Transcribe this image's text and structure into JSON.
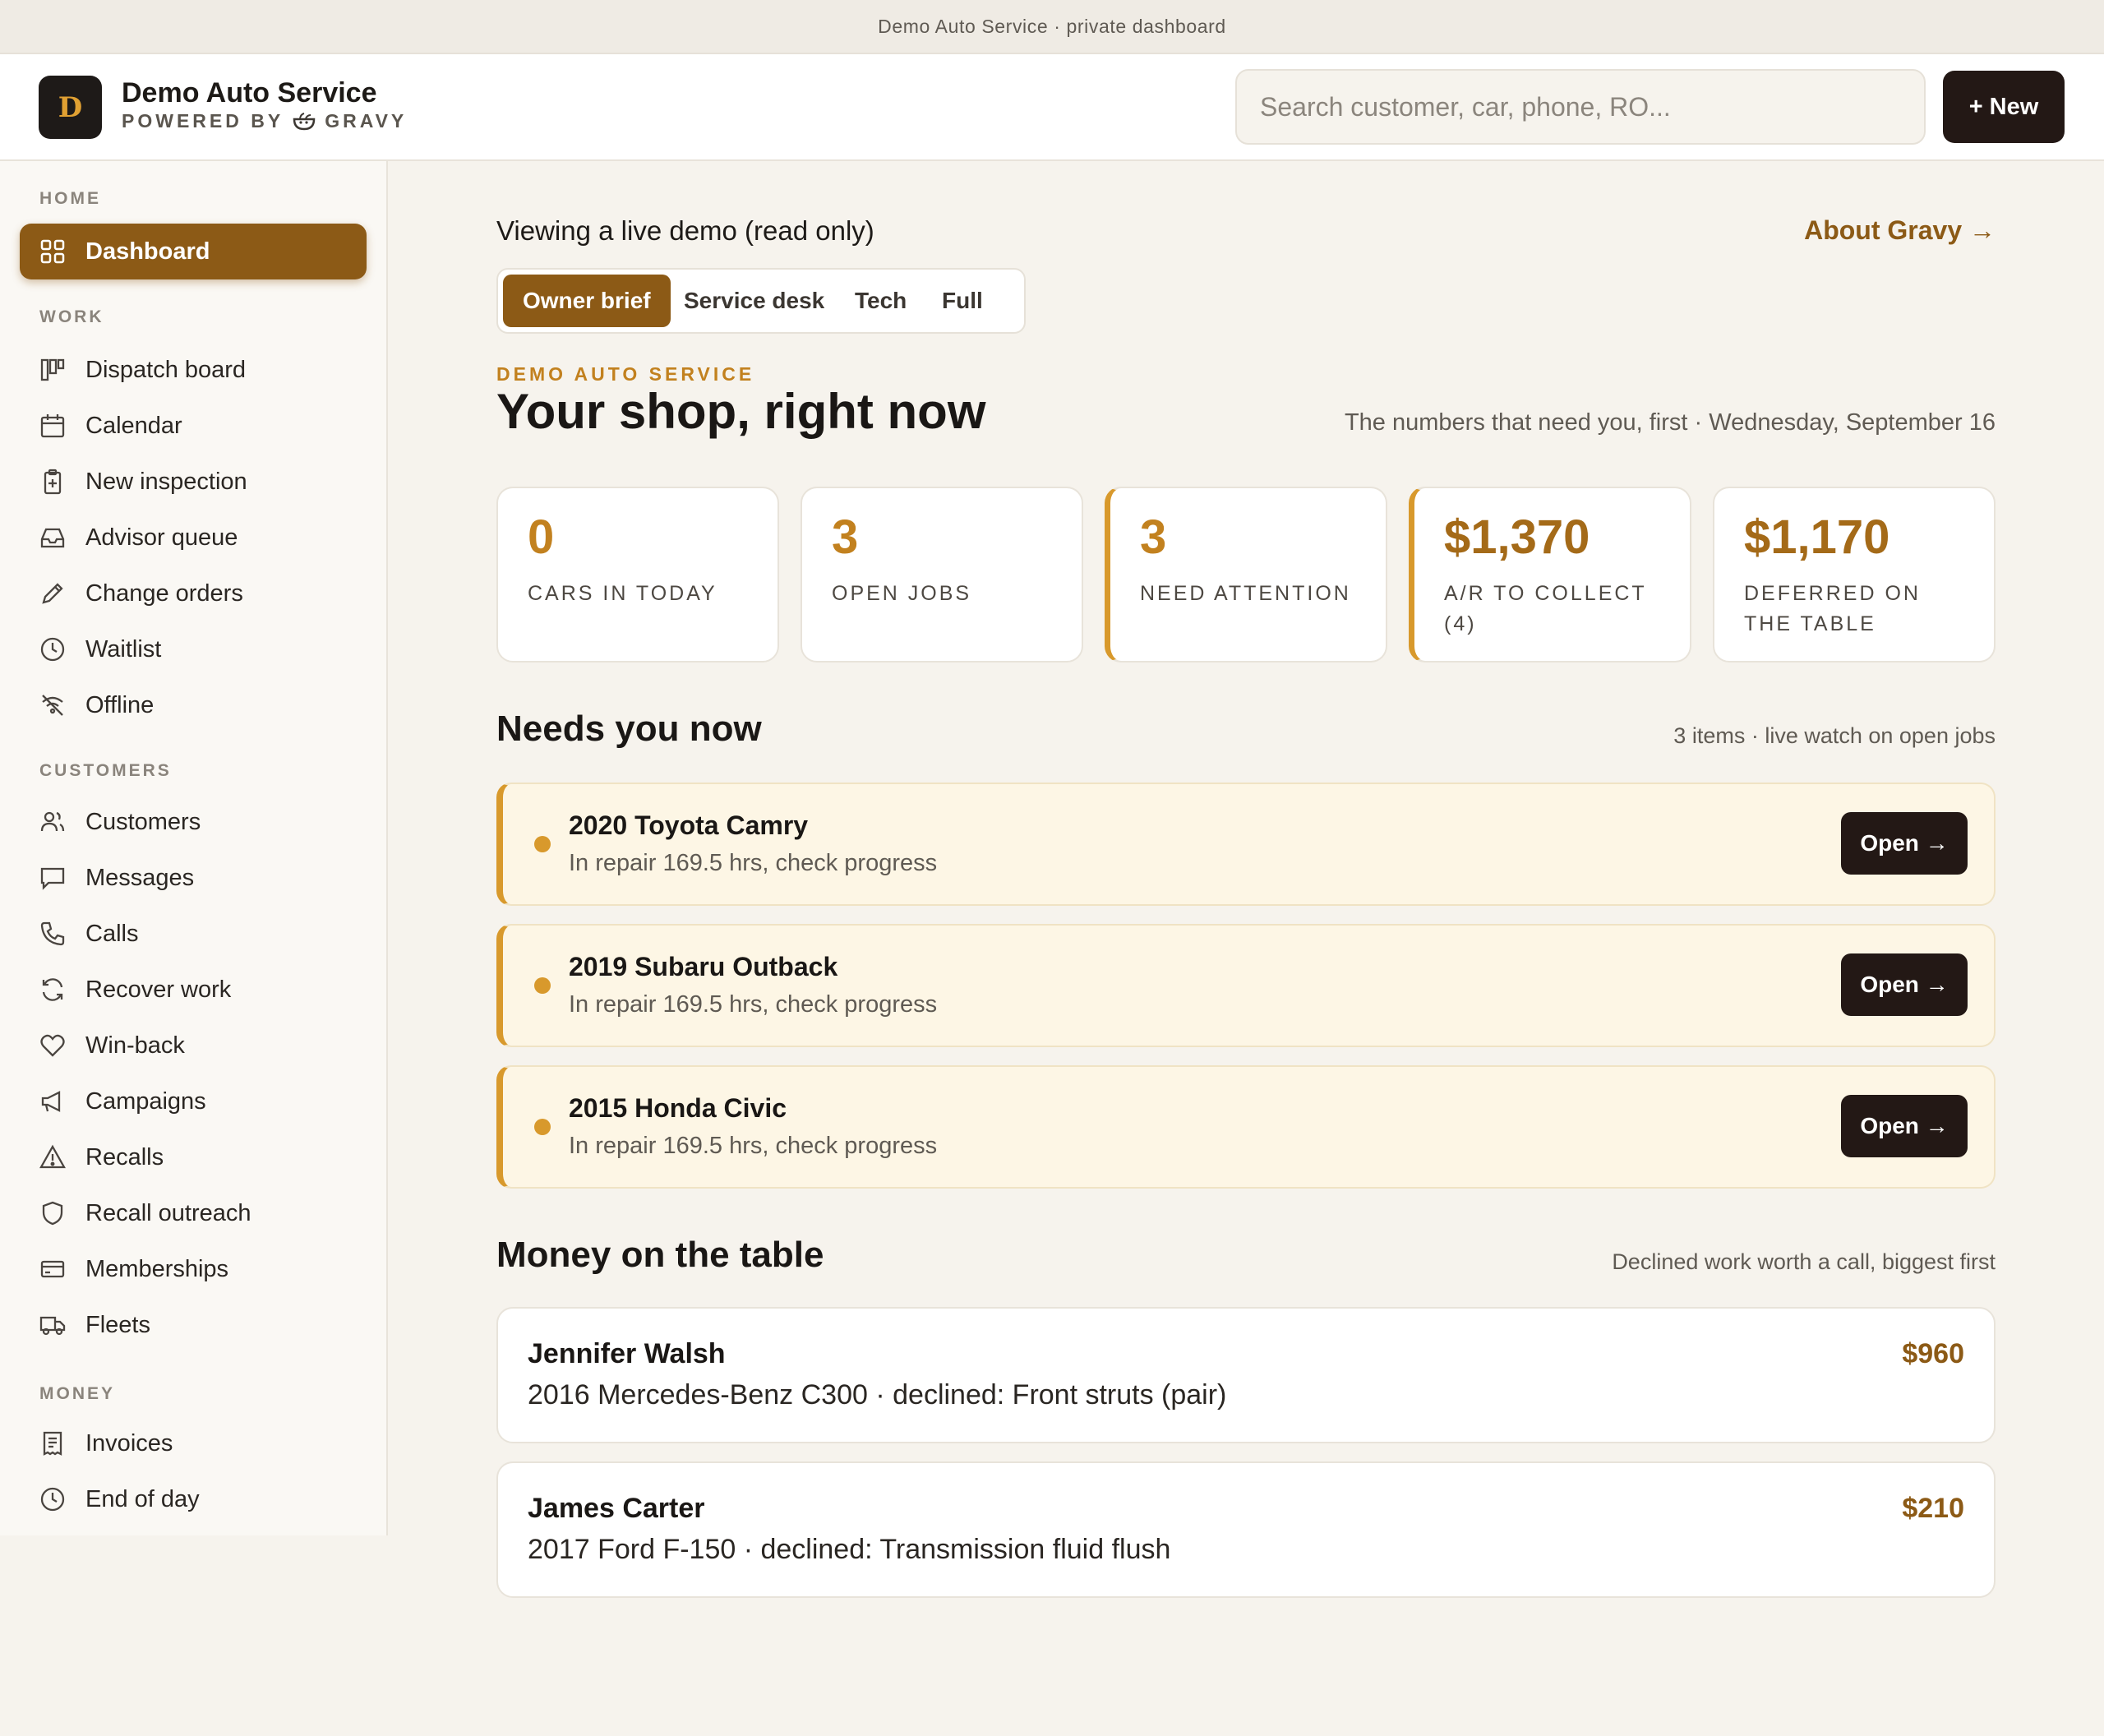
{
  "banner": {
    "text": "Demo Auto Service · private dashboard"
  },
  "header": {
    "logo_letter": "D",
    "brand_name": "Demo Auto Service",
    "powered_prefix": "POWERED BY",
    "powered_brand": "GRAVY",
    "search_placeholder": "Search customer, car, phone, RO...",
    "new_label": "+ New"
  },
  "sidebar": {
    "sections": [
      {
        "label": "HOME",
        "items": [
          {
            "label": "Dashboard",
            "icon": "grid-icon",
            "active": true
          }
        ]
      },
      {
        "label": "WORK",
        "items": [
          {
            "label": "Dispatch board",
            "icon": "board-icon"
          },
          {
            "label": "Calendar",
            "icon": "calendar-icon"
          },
          {
            "label": "New inspection",
            "icon": "clipboard-plus-icon"
          },
          {
            "label": "Advisor queue",
            "icon": "inbox-icon"
          },
          {
            "label": "Change orders",
            "icon": "pencil-icon"
          },
          {
            "label": "Waitlist",
            "icon": "clock-icon"
          },
          {
            "label": "Offline",
            "icon": "offline-icon"
          }
        ]
      },
      {
        "label": "CUSTOMERS",
        "items": [
          {
            "label": "Customers",
            "icon": "users-icon"
          },
          {
            "label": "Messages",
            "icon": "message-icon"
          },
          {
            "label": "Calls",
            "icon": "phone-icon"
          },
          {
            "label": "Recover work",
            "icon": "refresh-icon"
          },
          {
            "label": "Win-back",
            "icon": "heart-icon"
          },
          {
            "label": "Campaigns",
            "icon": "megaphone-icon"
          },
          {
            "label": "Recalls",
            "icon": "warning-icon"
          },
          {
            "label": "Recall outreach",
            "icon": "shield-icon"
          },
          {
            "label": "Memberships",
            "icon": "card-icon"
          },
          {
            "label": "Fleets",
            "icon": "truck-icon"
          }
        ]
      },
      {
        "label": "MONEY",
        "items": [
          {
            "label": "Invoices",
            "icon": "receipt-icon"
          },
          {
            "label": "End of day",
            "icon": "clock-icon"
          }
        ]
      }
    ]
  },
  "main": {
    "viewing_text": "Viewing a live demo (read only)",
    "about_link": "About Gravy →",
    "tabs": [
      "Owner brief",
      "Service desk",
      "Tech",
      "Full"
    ],
    "active_tab": "Owner brief",
    "eyebrow": "DEMO AUTO SERVICE",
    "title": "Your shop, right now",
    "subtitle": "The numbers that need you, first · Wednesday, September 16",
    "stats": [
      {
        "value": "0",
        "label": "CARS IN TODAY",
        "accent": false
      },
      {
        "value": "3",
        "label": "OPEN JOBS",
        "accent": false
      },
      {
        "value": "3",
        "label": "NEED ATTENTION",
        "accent": true
      },
      {
        "value": "$1,370",
        "label": "A/R TO COLLECT (4)",
        "accent": true
      },
      {
        "value": "$1,170",
        "label": "DEFERRED ON THE TABLE",
        "accent": false
      }
    ],
    "needs": {
      "title": "Needs you now",
      "meta": "3 items · live watch on open jobs",
      "items": [
        {
          "vehicle": "2020 Toyota Camry",
          "status": "In repair 169.5 hrs, check progress",
          "action": "Open →"
        },
        {
          "vehicle": "2019 Subaru Outback",
          "status": "In repair 169.5 hrs, check progress",
          "action": "Open →"
        },
        {
          "vehicle": "2015 Honda Civic",
          "status": "In repair 169.5 hrs, check progress",
          "action": "Open →"
        }
      ]
    },
    "money": {
      "title": "Money on the table",
      "meta": "Declined work worth a call, biggest first",
      "items": [
        {
          "customer": "Jennifer Walsh",
          "detail": "2016 Mercedes-Benz C300 · declined: Front struts (pair)",
          "amount": "$960"
        },
        {
          "customer": "James Carter",
          "detail": "2017 Ford F-150 · declined: Transmission fluid flush",
          "amount": "$210"
        }
      ]
    }
  },
  "colors": {
    "accent": "#8c5a16",
    "gold": "#d8992c",
    "dark": "#231815",
    "bg": "#f6f3ed"
  }
}
